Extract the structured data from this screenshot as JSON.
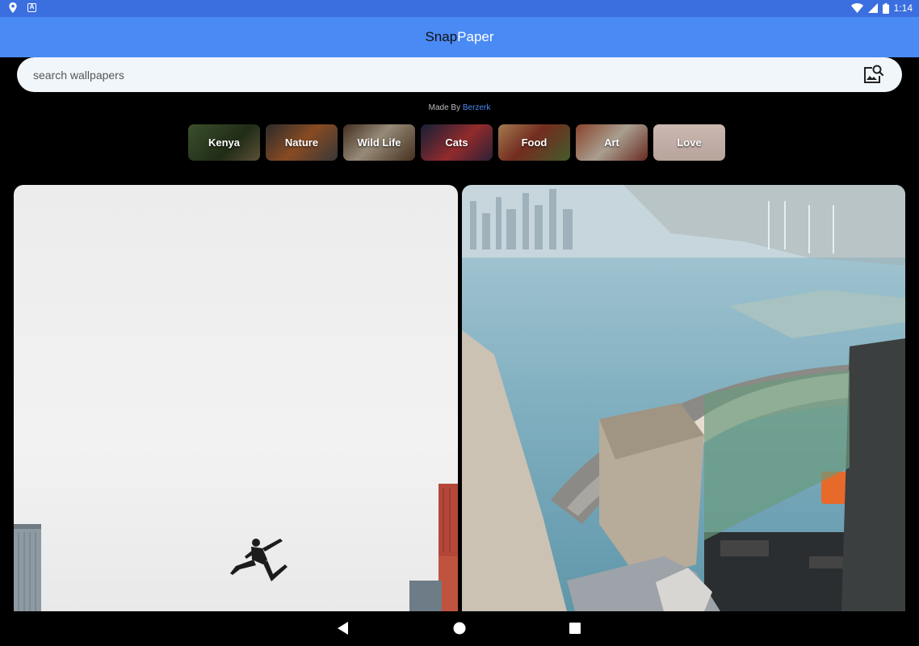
{
  "status_bar": {
    "time": "1:14",
    "icons": [
      "location-icon",
      "keyboard-a-icon",
      "wifi-icon",
      "signal-icon",
      "battery-icon"
    ]
  },
  "app": {
    "title_part1": "Snap",
    "title_part2": "Paper"
  },
  "search": {
    "placeholder": "search wallpapers",
    "button_icon": "image-search-icon"
  },
  "credit": {
    "prefix": "Made By ",
    "author": "Berzerk"
  },
  "categories": [
    {
      "label": "Kenya"
    },
    {
      "label": "Nature"
    },
    {
      "label": "Wild Life"
    },
    {
      "label": "Cats"
    },
    {
      "label": "Food"
    },
    {
      "label": "Art"
    },
    {
      "label": "Love"
    }
  ],
  "wallpapers": [
    {
      "subject": "person jumping between shipping containers"
    },
    {
      "subject": "city view from helicopter"
    }
  ],
  "nav_bar": {
    "icons": [
      "back-icon",
      "home-icon",
      "recents-icon"
    ]
  },
  "colors": {
    "status_bar": "#3b6fe0",
    "app_bar": "#4a8af5",
    "accent": "#4a8af5",
    "background": "#000000",
    "search_bg": "#f1f6fb"
  }
}
